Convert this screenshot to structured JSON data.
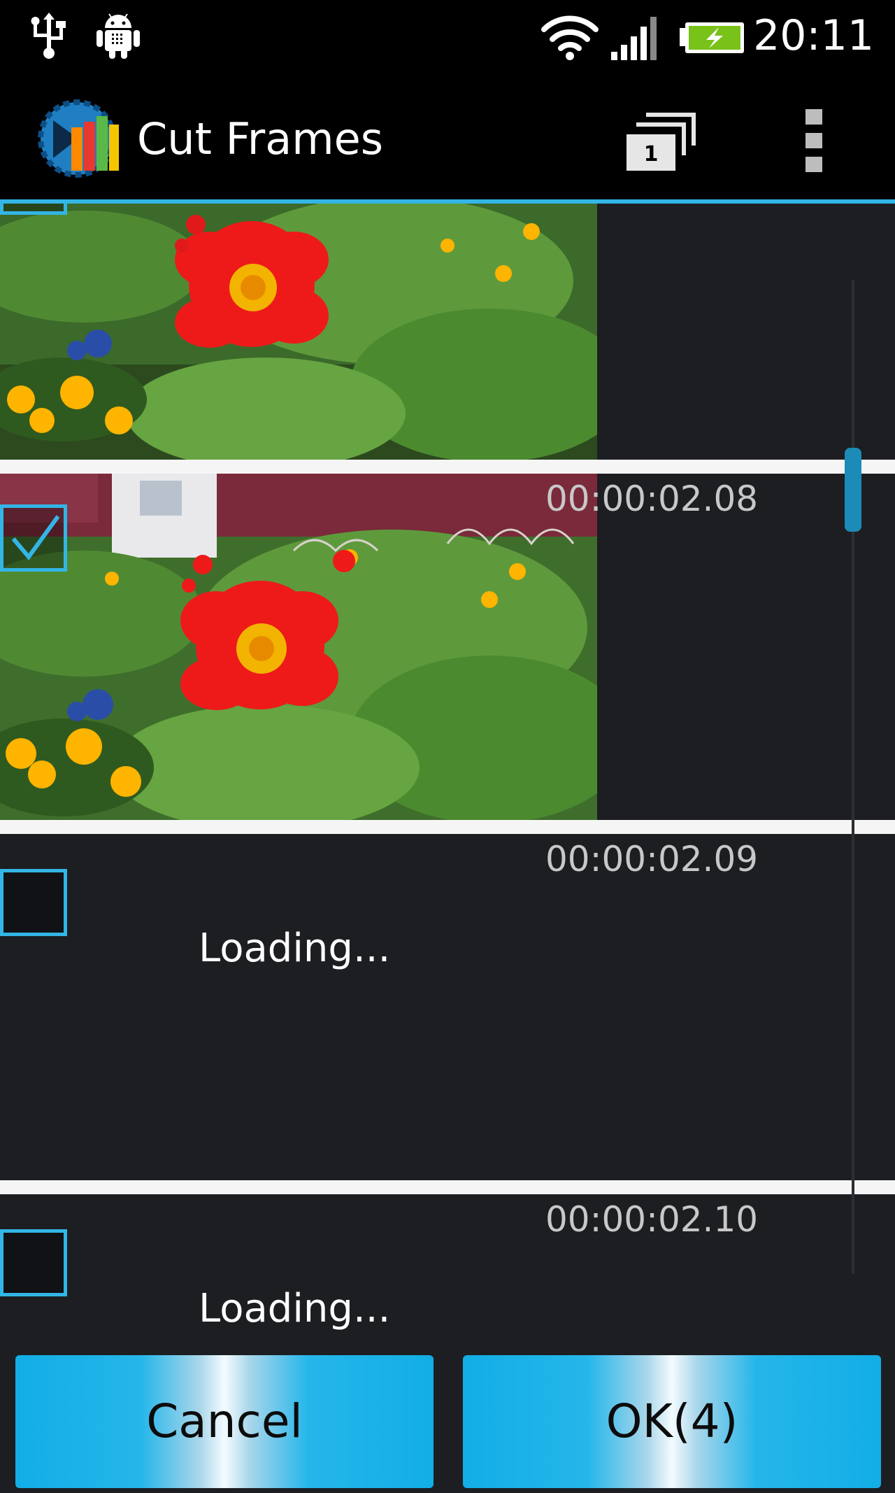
{
  "status_bar": {
    "time": "20:11",
    "icons": [
      "usb-icon",
      "android-debug-icon",
      "wifi-icon",
      "signal-icon",
      "battery-charging-icon"
    ]
  },
  "action_bar": {
    "title": "Cut Frames",
    "frames_counter": "1",
    "logo": "app-logo-icon",
    "overflow": "overflow-menu-icon"
  },
  "frames": [
    {
      "timestamp": "",
      "checked": true,
      "state": "loaded"
    },
    {
      "timestamp": "00:00:02.08",
      "checked": true,
      "state": "loaded"
    },
    {
      "timestamp": "00:00:02.09",
      "checked": false,
      "state": "loading",
      "loading_text": "Loading..."
    },
    {
      "timestamp": "00:00:02.10",
      "checked": false,
      "state": "loading",
      "loading_text": "Loading..."
    }
  ],
  "buttons": {
    "cancel": "Cancel",
    "ok": "OK(4)"
  },
  "colors": {
    "accent": "#33b5e5",
    "background": "#1c1e22",
    "button": "#12aee6"
  }
}
